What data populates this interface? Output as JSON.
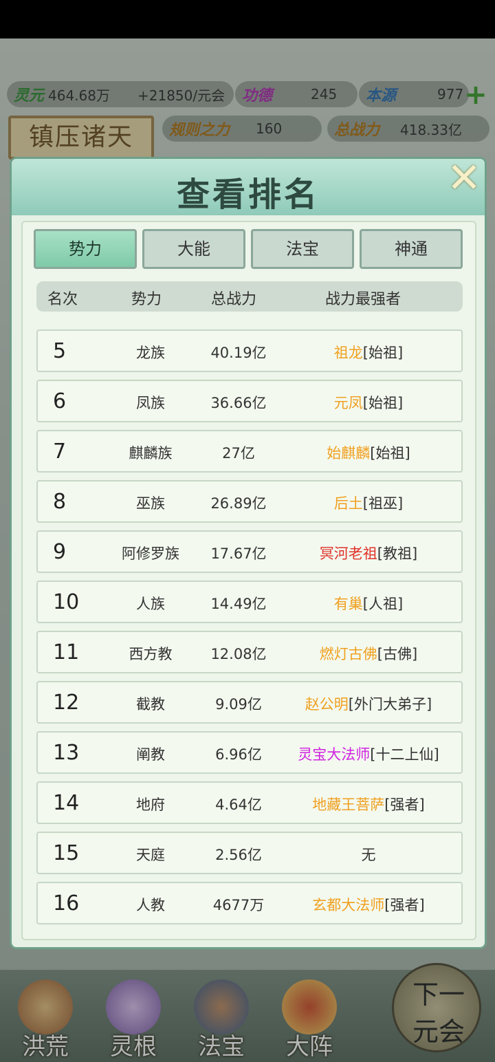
{
  "resources": {
    "lingyuan_label": "灵元",
    "lingyuan_value": "464.68万",
    "lingyuan_rate": "+21850/元会",
    "gongde_label": "功德",
    "gongde_value": "245",
    "benyuan_label": "本源",
    "benyuan_value": "977",
    "guize_label": "规则之力",
    "guize_value": "160",
    "zongzhanli_label": "总战力",
    "zongzhanli_value": "418.33亿"
  },
  "banner": "镇压诸天",
  "modal": {
    "title": "查看排名",
    "tabs": [
      {
        "label": "势力"
      },
      {
        "label": "大能"
      },
      {
        "label": "法宝"
      },
      {
        "label": "神通"
      }
    ],
    "columns": {
      "rank": "名次",
      "force": "势力",
      "power": "总战力",
      "top": "战力最强者"
    },
    "rows": [
      {
        "rank": "5",
        "force": "龙族",
        "power": "40.19亿",
        "name": "祖龙",
        "title": "[始祖]",
        "name_color": "#f0a020"
      },
      {
        "rank": "6",
        "force": "凤族",
        "power": "36.66亿",
        "name": "元凤",
        "title": "[始祖]",
        "name_color": "#f0a020"
      },
      {
        "rank": "7",
        "force": "麒麟族",
        "power": "27亿",
        "name": "始麒麟",
        "title": "[始祖]",
        "name_color": "#f0a020"
      },
      {
        "rank": "8",
        "force": "巫族",
        "power": "26.89亿",
        "name": "后土",
        "title": "[祖巫]",
        "name_color": "#f0a020"
      },
      {
        "rank": "9",
        "force": "阿修罗族",
        "power": "17.67亿",
        "name": "冥河老祖",
        "title": "[教祖]",
        "name_color": "#e0322a"
      },
      {
        "rank": "10",
        "force": "人族",
        "power": "14.49亿",
        "name": "有巢",
        "title": "[人祖]",
        "name_color": "#f0a020"
      },
      {
        "rank": "11",
        "force": "西方教",
        "power": "12.08亿",
        "name": "燃灯古佛",
        "title": "[古佛]",
        "name_color": "#f0a020"
      },
      {
        "rank": "12",
        "force": "截教",
        "power": "9.09亿",
        "name": "赵公明",
        "title": "[外门大弟子]",
        "name_color": "#f0a020"
      },
      {
        "rank": "13",
        "force": "阐教",
        "power": "6.96亿",
        "name": "灵宝大法师",
        "title": "[十二上仙]",
        "name_color": "#d020e0"
      },
      {
        "rank": "14",
        "force": "地府",
        "power": "4.64亿",
        "name": "地藏王菩萨",
        "title": "[强者]",
        "name_color": "#f0a020"
      },
      {
        "rank": "15",
        "force": "天庭",
        "power": "2.56亿",
        "name": "",
        "title": "无",
        "name_color": "#333333"
      },
      {
        "rank": "16",
        "force": "人教",
        "power": "4677万",
        "name": "玄都大法师",
        "title": "[强者]",
        "name_color": "#f0a020"
      }
    ]
  },
  "nav": {
    "honghuang": "洪荒",
    "linggen": "灵根",
    "fabao": "法宝",
    "dazhen": "大阵",
    "next_line1": "下一",
    "next_line2": "元会"
  }
}
